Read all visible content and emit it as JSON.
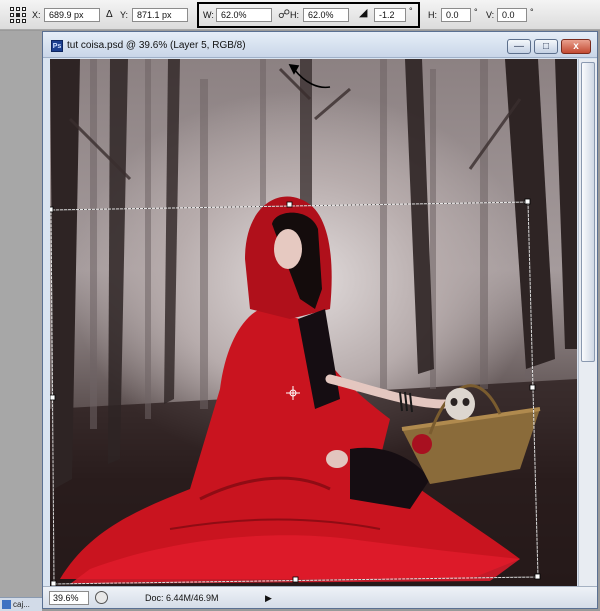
{
  "options_bar": {
    "x": {
      "label": "X:",
      "value": "689.9 px"
    },
    "delta_symbol": "Δ",
    "y": {
      "label": "Y:",
      "value": "871.1 px"
    },
    "w": {
      "label": "W:",
      "value": "62.0%"
    },
    "h": {
      "label": "H:",
      "value": "62.0%"
    },
    "rotate": {
      "value": "-1.2",
      "unit": "°"
    },
    "skew_h": {
      "label": "H:",
      "value": "0.0",
      "unit": "°"
    },
    "skew_v": {
      "label": "V:",
      "value": "0.0",
      "unit": "°"
    },
    "link_icon": "chain-link-icon"
  },
  "document": {
    "title": "tut coisa.psd @ 39.6% (Layer 5, RGB/8)",
    "app_icon_text": "Ps",
    "buttons": {
      "minimize": "—",
      "maximize": "□",
      "close": "x"
    }
  },
  "status_bar": {
    "zoom": "39.6%",
    "doc_size": "Doc: 6.44M/46.9M",
    "arrow": "▶"
  },
  "taskbar": {
    "item_label": "caj..."
  }
}
